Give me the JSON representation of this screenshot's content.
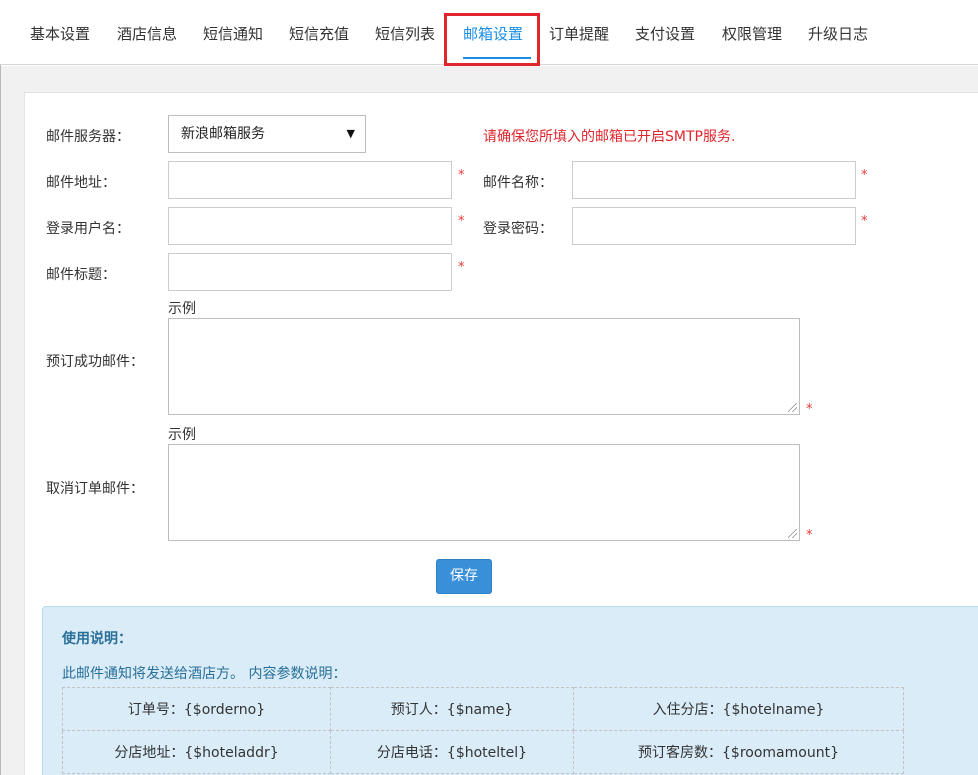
{
  "nav": {
    "tabs": [
      {
        "label": "基本设置"
      },
      {
        "label": "酒店信息"
      },
      {
        "label": "短信通知"
      },
      {
        "label": "短信充值"
      },
      {
        "label": "短信列表"
      },
      {
        "label": "邮箱设置"
      },
      {
        "label": "订单提醒"
      },
      {
        "label": "支付设置"
      },
      {
        "label": "权限管理"
      },
      {
        "label": "升级日志"
      }
    ],
    "active_index": 5,
    "accent_color": "#1a8ee6",
    "highlight_color": "#e0262c"
  },
  "form": {
    "server_label": "邮件服务器：",
    "server_selected": "新浪邮箱服务",
    "server_hint": "请确保您所填入的邮箱已开启SMTP服务.",
    "address_label": "邮件地址：",
    "address_value": "",
    "sender_name_label": "邮件名称：",
    "sender_name_value": "",
    "username_label": "登录用户名：",
    "username_value": "",
    "password_label": "登录密码：",
    "password_value": "",
    "subject_label": "邮件标题：",
    "subject_value": "",
    "booking_success_label": "预订成功邮件：",
    "cancel_order_label": "取消订单邮件：",
    "example_link": "示例",
    "required_mark": "*",
    "save_label": "保存"
  },
  "info": {
    "title": "使用说明：",
    "description": "此邮件通知将发送给酒店方。 内容参数说明：",
    "params": [
      [
        "订单号：{$orderno}",
        "预订人：{$name}",
        "入住分店：{$hotelname}"
      ],
      [
        "分店地址：{$hoteladdr}",
        "分店电话：{$hoteltel}",
        "预订客房数：{$roomamount}"
      ]
    ]
  }
}
